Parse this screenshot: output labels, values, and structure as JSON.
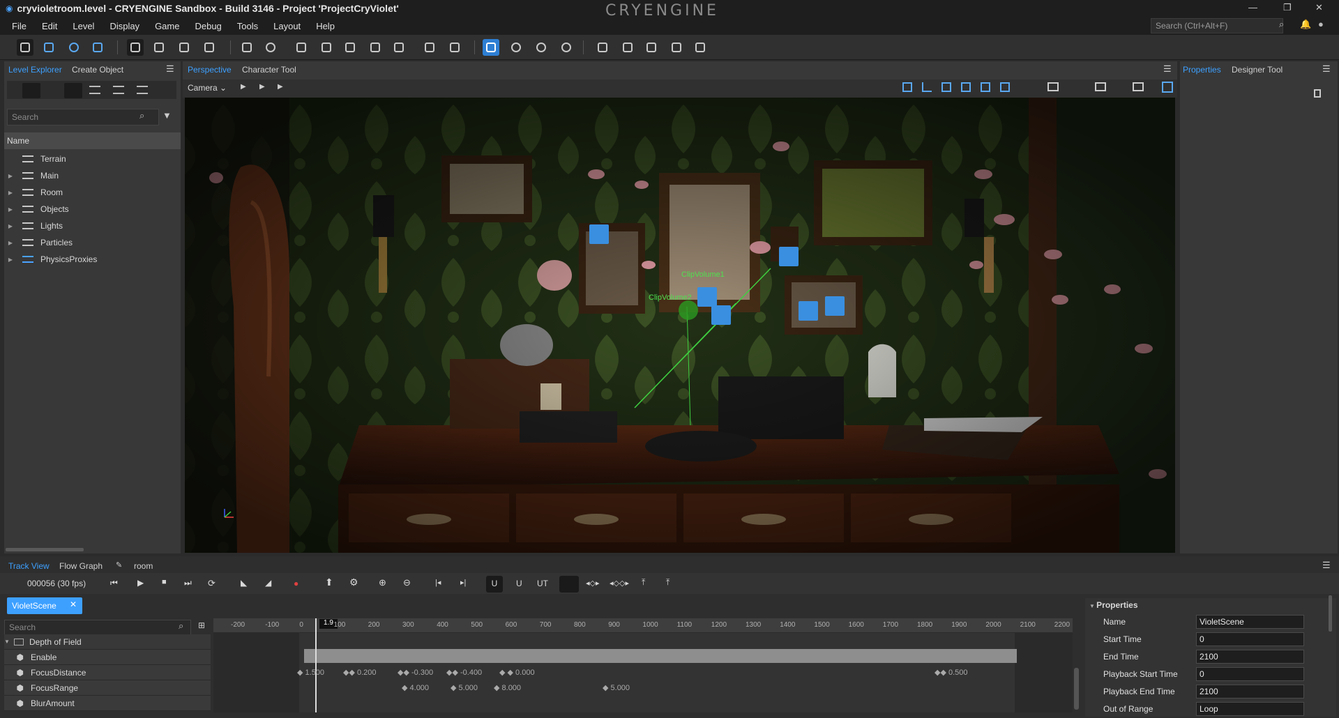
{
  "window": {
    "title": "cryvioletroom.level - CRYENGINE Sandbox - Build 3146 - Project 'ProjectCryViolet'",
    "logo_text": "CRYENGINE"
  },
  "menu": [
    "File",
    "Edit",
    "Level",
    "Display",
    "Game",
    "Debug",
    "Tools",
    "Layout",
    "Help"
  ],
  "top_search": {
    "placeholder": "Search (Ctrl+Alt+F)"
  },
  "left_panel": {
    "tabs": [
      "Level Explorer",
      "Create Object"
    ],
    "search_placeholder": "Search",
    "column_header": "Name",
    "layers": [
      "Terrain",
      "Main",
      "Room",
      "Objects",
      "Lights",
      "Particles",
      "PhysicsProxies"
    ]
  },
  "viewport": {
    "tabs": [
      "Perspective",
      "Character Tool"
    ],
    "camera_label": "Camera",
    "labels": [
      "ClipVolume1",
      "ClipVolume2"
    ]
  },
  "right_panel": {
    "tabs": [
      "Properties",
      "Designer Tool"
    ]
  },
  "trackview": {
    "tabs": [
      "Track View",
      "Flow Graph",
      "room"
    ],
    "frame": "000056 (30 fps)",
    "sequence": "VioletScene",
    "search_placeholder": "Search",
    "playhead": "1.9",
    "ruler": [
      "-200",
      "-100",
      "0",
      "100",
      "200",
      "300",
      "400",
      "500",
      "600",
      "700",
      "800",
      "900",
      "1000",
      "1100",
      "1200",
      "1300",
      "1400",
      "1500",
      "1600",
      "1700",
      "1800",
      "1900",
      "2000",
      "2100",
      "2200"
    ],
    "tracks": [
      {
        "name": "Depth of Field",
        "group": true
      },
      {
        "name": "Enable"
      },
      {
        "name": "FocusDistance"
      },
      {
        "name": "FocusRange"
      },
      {
        "name": "BlurAmount"
      }
    ],
    "focus_distance_keys": [
      "1.500",
      "0.200",
      "-0.300",
      "-0.400",
      "0.000",
      "0.500"
    ],
    "focus_range_keys": [
      "4.000",
      "5.000",
      "8.000",
      "5.000"
    ]
  },
  "properties": {
    "header": "Properties",
    "rows": [
      {
        "label": "Name",
        "value": "VioletScene"
      },
      {
        "label": "Start Time",
        "value": "0"
      },
      {
        "label": "End Time",
        "value": "2100"
      },
      {
        "label": "Playback Start Time",
        "value": "0"
      },
      {
        "label": "Playback End Time",
        "value": "2100"
      },
      {
        "label": "Out of Range",
        "value": "Loop"
      }
    ]
  },
  "colors": {
    "accent": "#2e7fd4",
    "tab_active": "#3da0ff",
    "wallpaper": "#2a3a1c",
    "desk": "#5a2a14"
  }
}
